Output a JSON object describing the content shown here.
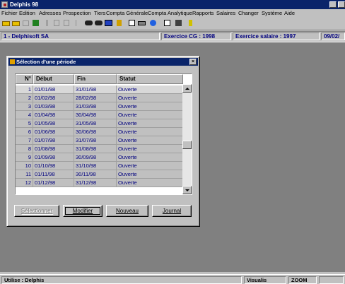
{
  "app": {
    "title": "Delphis 98"
  },
  "menu": [
    "Fichier",
    "Edition",
    "Adresses",
    "Prospection",
    "Tiers",
    "Compta Générale",
    "Compta Analytique",
    "Rapports",
    "Salaires",
    "Changer",
    "Système",
    "Aide"
  ],
  "infobar": {
    "company": "1 - Delphisoft SA",
    "exercice_cg": "Exercice CG : 1998",
    "exercice_salaire": "Exercice salaire :  1997",
    "date": "09/02/"
  },
  "dialog": {
    "title": "Sélection d'une période",
    "columns": [
      "N°",
      "Début",
      "Fin",
      "Statut"
    ],
    "rows": [
      {
        "n": "1",
        "debut": "01/01/98",
        "fin": "31/01/98",
        "statut": "Ouverte"
      },
      {
        "n": "2",
        "debut": "01/02/98",
        "fin": "28/02/98",
        "statut": "Ouverte"
      },
      {
        "n": "3",
        "debut": "01/03/98",
        "fin": "31/03/98",
        "statut": "Ouverte"
      },
      {
        "n": "4",
        "debut": "01/04/98",
        "fin": "30/04/98",
        "statut": "Ouverte"
      },
      {
        "n": "5",
        "debut": "01/05/98",
        "fin": "31/05/98",
        "statut": "Ouverte"
      },
      {
        "n": "6",
        "debut": "01/06/98",
        "fin": "30/06/98",
        "statut": "Ouverte"
      },
      {
        "n": "7",
        "debut": "01/07/98",
        "fin": "31/07/98",
        "statut": "Ouverte"
      },
      {
        "n": "8",
        "debut": "01/08/98",
        "fin": "31/08/98",
        "statut": "Ouverte"
      },
      {
        "n": "9",
        "debut": "01/09/98",
        "fin": "30/09/98",
        "statut": "Ouverte"
      },
      {
        "n": "10",
        "debut": "01/10/98",
        "fin": "31/10/98",
        "statut": "Ouverte"
      },
      {
        "n": "11",
        "debut": "01/11/98",
        "fin": "30/11/98",
        "statut": "Ouverte"
      },
      {
        "n": "12",
        "debut": "01/12/98",
        "fin": "31/12/98",
        "statut": "Ouverte"
      }
    ],
    "buttons": {
      "select": "Sélectionner",
      "modify": "Modifier",
      "new": "Nouveau",
      "journal": "Journal"
    }
  },
  "status": {
    "user": "Utilise : Delphis",
    "mode": "Visualis",
    "zoom": "ZOOM"
  }
}
